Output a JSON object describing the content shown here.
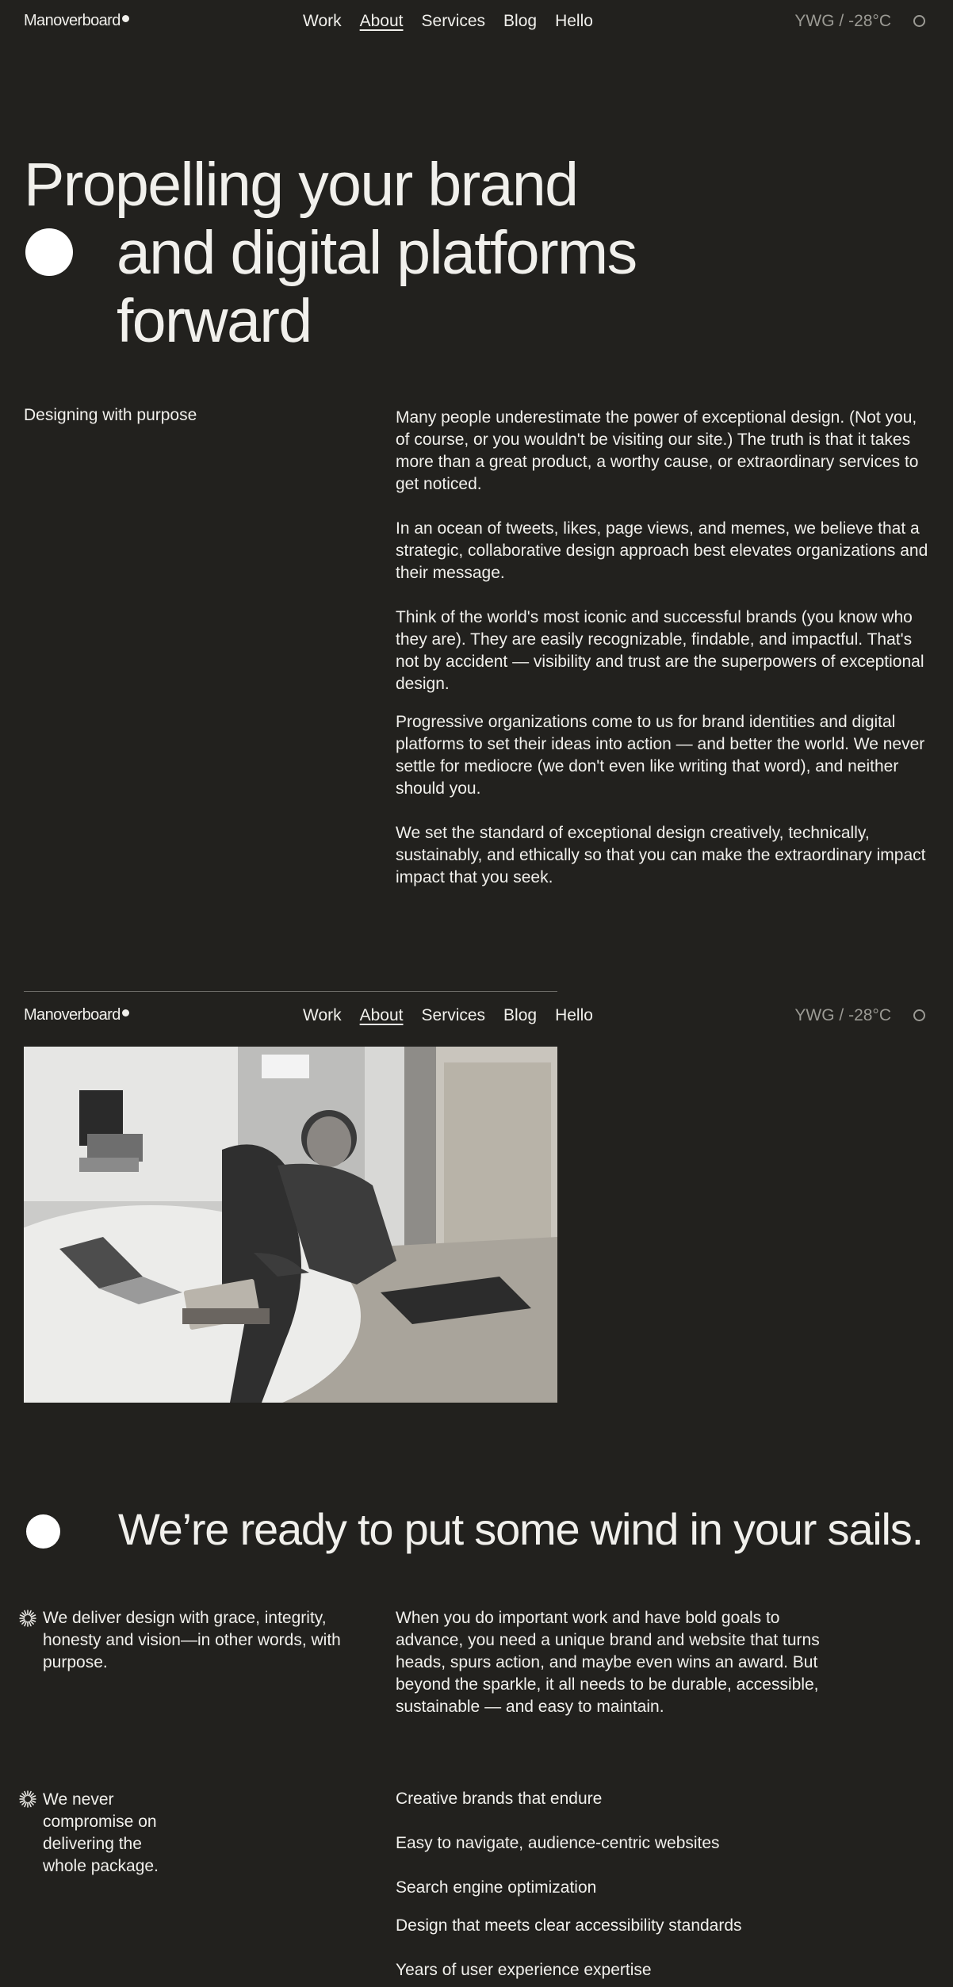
{
  "nav": {
    "logo": "Manoverboard",
    "items": [
      "Work",
      "About",
      "Services",
      "Blog",
      "Hello"
    ],
    "active": "About",
    "weather": "YWG / -28°C"
  },
  "hero": {
    "line1": "Propelling your brand",
    "line2": "and digital platforms",
    "line3": "forward"
  },
  "intro": {
    "label": "Designing with purpose",
    "paragraphs": [
      "Many people underestimate the power of exceptional design. (Not you, of course, or you wouldn't be visiting our site.) The truth is that it takes more than a great product, a worthy cause, or extraordinary services to get noticed.",
      "In an ocean of tweets, likes, page views, and memes, we believe that a strategic, collaborative design approach best elevates organizations and their message.",
      "Think of the world's most iconic and successful brands (you know who they are). They are easily recognizable, findable, and impactful. That's not by accident — visibility and trust are the superpowers of exceptional design.",
      "Progressive organizations come to us for brand identities and digital platforms to set their ideas into action — and better the world. We never settle for mediocre (we don't even like writing that word), and neither should you.",
      "We set the standard of exceptional design creatively, technically, sustainably, and ethically so that you can make the extraordinary impact impact that you seek."
    ]
  },
  "photo": {
    "alt": "man-at-desk-photo"
  },
  "section2": {
    "tagline": "We’re ready to put some wind in your sails.",
    "feature1": "We deliver design with grace, integrity, honesty and vision—in other words, with purpose.",
    "feature1_body": "When you do important work and have bold goals to advance, you need a unique brand and website that turns heads, spurs action, and maybe even wins an award. But beyond the sparkle, it all needs to be durable, accessible, sustainable — and easy to maintain.",
    "feature2": "We never compromise on delivering the whole package.",
    "list": [
      "Creative brands that endure",
      "Easy to navigate, audience-centric websites",
      "Search engine optimization",
      "Design that meets clear accessibility standards",
      "Years of user experience expertise"
    ]
  },
  "colors": {
    "background": "#22211e",
    "text": "#f1f0ec",
    "muted": "#9b9a94"
  }
}
